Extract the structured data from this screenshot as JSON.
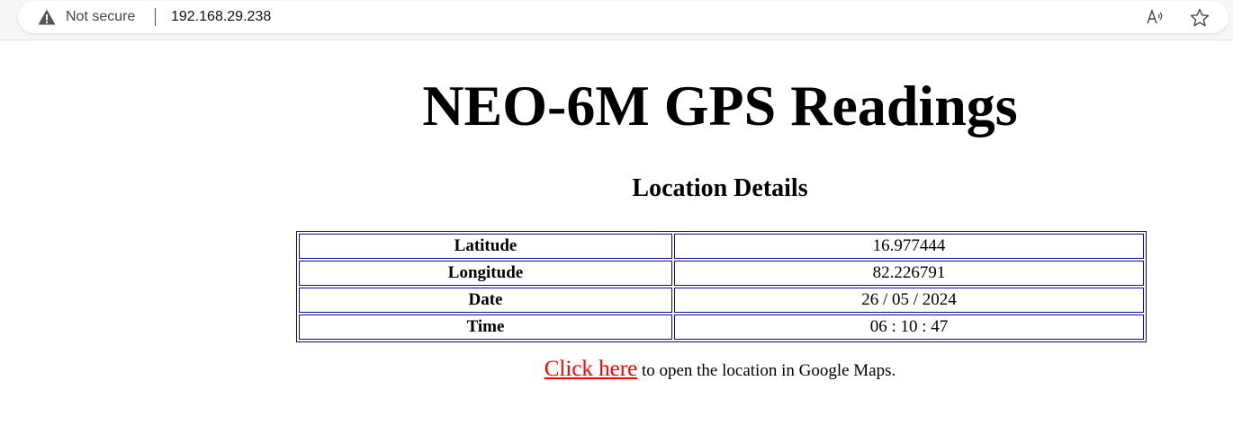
{
  "browser": {
    "security_label": "Not secure",
    "url": "192.168.29.238",
    "icons": [
      "warning-icon",
      "read-aloud-icon",
      "favorite-star-icon"
    ]
  },
  "page": {
    "title": "NEO-6M GPS Readings",
    "subtitle": "Location Details",
    "rows": [
      {
        "label": "Latitude",
        "value": "16.977444"
      },
      {
        "label": "Longitude",
        "value": "82.226791"
      },
      {
        "label": "Date",
        "value": "26 / 05 / 2024"
      },
      {
        "label": "Time",
        "value": "06 : 10 : 47"
      }
    ],
    "maps_link_text": "Click here",
    "maps_suffix": " to open the location in Google Maps.",
    "link_color": "#ff0000",
    "table_border_color": "#0b0b8a"
  }
}
